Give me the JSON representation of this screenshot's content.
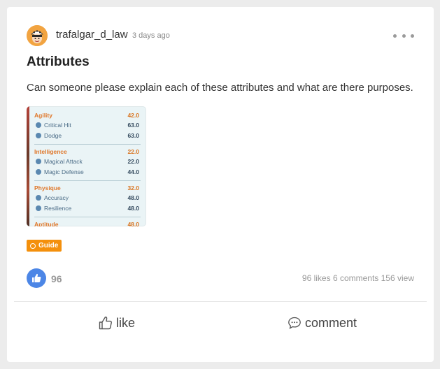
{
  "post": {
    "username": "trafalgar_d_law",
    "time": "3 days ago",
    "title": "Attributes",
    "body": "Can someone please explain each of these attributes and what are there purposes.",
    "tag": "Guide"
  },
  "image": {
    "groups": [
      {
        "name": "Agility",
        "value": "42.0",
        "items": [
          {
            "label": "Critical Hit",
            "value": "63.0"
          },
          {
            "label": "Dodge",
            "value": "63.0"
          }
        ]
      },
      {
        "name": "Intelligence",
        "value": "22.0",
        "items": [
          {
            "label": "Magical Attack",
            "value": "22.0"
          },
          {
            "label": "Magic Defense",
            "value": "44.0"
          }
        ]
      },
      {
        "name": "Physique",
        "value": "32.0",
        "items": [
          {
            "label": "Accuracy",
            "value": "48.0"
          },
          {
            "label": "Resilience",
            "value": "48.0"
          }
        ]
      },
      {
        "name": "Aptitude",
        "value": "48.0",
        "items": []
      }
    ]
  },
  "engagement": {
    "like_count": "96",
    "stats": "96 likes 6 comments 156 view"
  },
  "actions": {
    "like_label": "like",
    "comment_label": "comment"
  },
  "colors": {
    "accent_like": "#4c86e6",
    "tag_bg": "#f4900c",
    "attribute_heading": "#e0782b"
  }
}
